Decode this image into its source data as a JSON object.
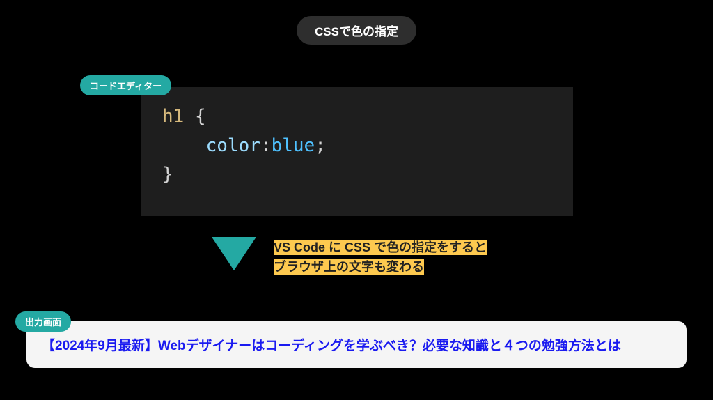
{
  "title_pill": "CSSで色の指定",
  "editor": {
    "label": "コードエディター",
    "code": {
      "selector": "h1",
      "brace_open": "{",
      "property": "color",
      "colon": ":",
      "value": "blue",
      "semicolon": ";",
      "brace_close": "}"
    }
  },
  "caption": {
    "line1": "VS Code に CSS で色の指定をすると",
    "line2": "ブラウザ上の文字も変わる"
  },
  "output": {
    "label": "出力画面",
    "text": "【2024年9月最新】Webデザイナーはコーディングを学ぶべき？必要な知識と４つの勉強方法とは"
  },
  "colors": {
    "accent_teal": "#24a9a3",
    "highlight_yellow": "#fdc94f",
    "output_text_blue": "#1a1af0",
    "editor_bg": "#1e1e1e",
    "pill_bg": "#2e2e2e"
  }
}
